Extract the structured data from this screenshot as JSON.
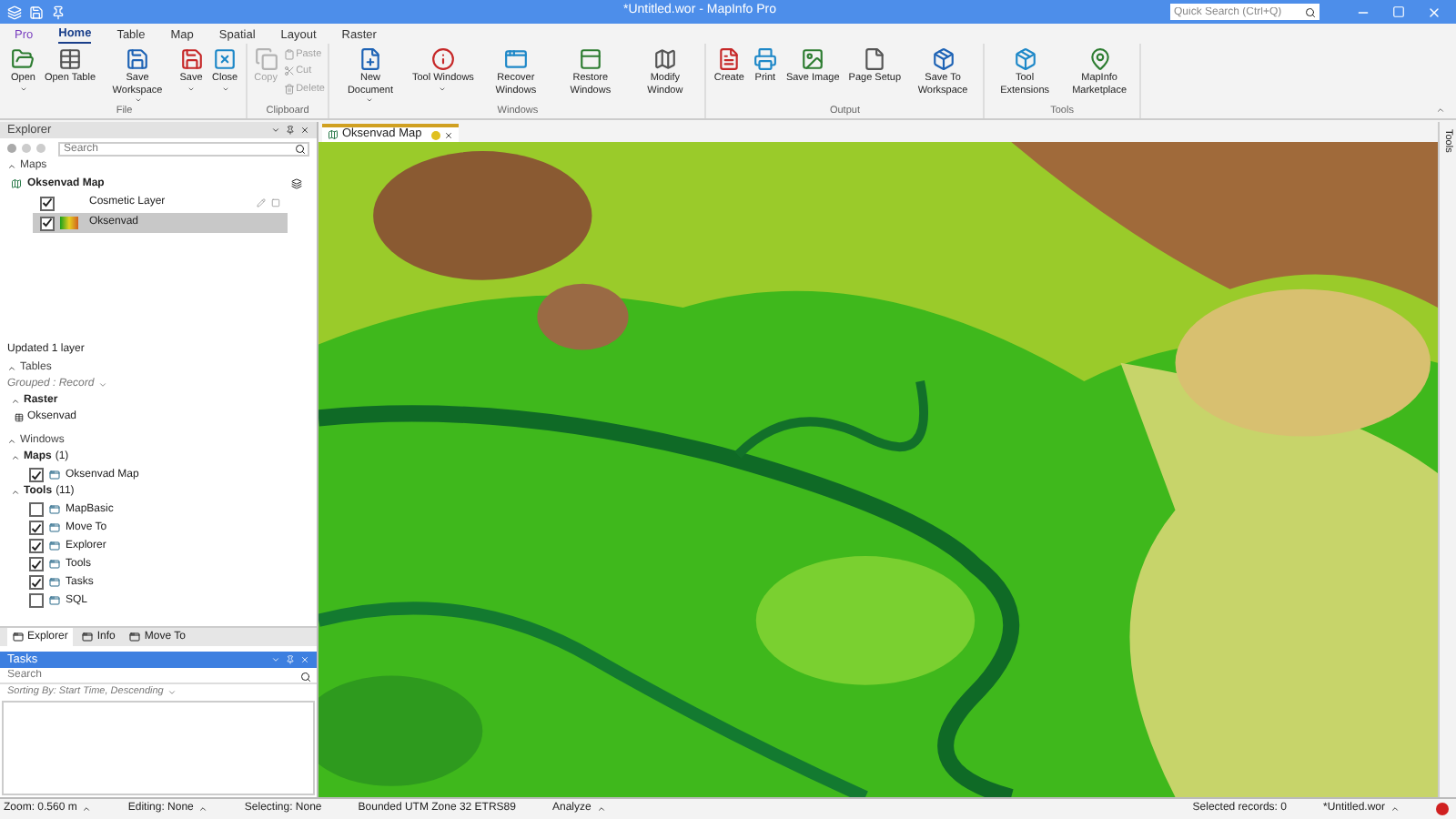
{
  "window": {
    "title": "*Untitled.wor - MapInfo Pro"
  },
  "quick_search": {
    "placeholder": "Quick Search (Ctrl+Q)"
  },
  "tabs": [
    {
      "label": "Pro",
      "selected": false
    },
    {
      "label": "Home",
      "selected": true
    },
    {
      "label": "Table",
      "selected": false
    },
    {
      "label": "Map",
      "selected": false
    },
    {
      "label": "Spatial",
      "selected": false
    },
    {
      "label": "Layout",
      "selected": false
    },
    {
      "label": "Raster",
      "selected": false
    }
  ],
  "ribbon": [
    {
      "label": "File",
      "buttons": [
        {
          "label": "Open",
          "disabled": false,
          "dropdown": true
        },
        {
          "label": "Open Table",
          "disabled": false,
          "dropdown": false
        },
        {
          "label": "Save Workspace",
          "disabled": false,
          "dropdown": true
        },
        {
          "label": "Save",
          "disabled": false,
          "dropdown": true
        },
        {
          "label": "Close",
          "disabled": false,
          "dropdown": true
        }
      ]
    },
    {
      "label": "Clipboard",
      "buttons": [
        {
          "label": "Copy",
          "disabled": true,
          "dropdown": false
        },
        {
          "label": "Paste",
          "disabled": true,
          "kind": "small"
        },
        {
          "label": "Cut",
          "disabled": true,
          "kind": "small"
        },
        {
          "label": "Delete",
          "disabled": true,
          "kind": "small"
        }
      ]
    },
    {
      "label": "Windows",
      "buttons": [
        {
          "label": "New Document",
          "disabled": false,
          "dropdown": true
        },
        {
          "label": "Tool Windows",
          "disabled": false,
          "dropdown": true
        },
        {
          "label": "Recover Windows",
          "disabled": false,
          "dropdown": false
        },
        {
          "label": "Restore Windows",
          "disabled": false,
          "dropdown": false
        },
        {
          "label": "Modify Window",
          "disabled": false,
          "dropdown": false
        }
      ]
    },
    {
      "label": "Output",
      "buttons": [
        {
          "label": "Create",
          "disabled": false,
          "dropdown": false
        },
        {
          "label": "Print",
          "disabled": false,
          "dropdown": false
        },
        {
          "label": "Save Image",
          "disabled": false,
          "dropdown": false
        },
        {
          "label": "Page Setup",
          "disabled": false,
          "dropdown": false
        },
        {
          "label": "Save To Workspace",
          "disabled": false,
          "dropdown": false
        }
      ]
    },
    {
      "label": "Tools",
      "buttons": [
        {
          "label": "Tool Extensions",
          "disabled": false,
          "dropdown": false
        },
        {
          "label": "MapInfo Marketplace",
          "disabled": false,
          "dropdown": false
        }
      ]
    }
  ],
  "explorer": {
    "title": "Explorer",
    "search": {
      "placeholder": "Search"
    },
    "maps_heading": "Maps",
    "map_name": "Oksenvad Map",
    "layers": [
      {
        "name": "Cosmetic Layer",
        "checked": true,
        "selected": false,
        "kind": "cosmetic"
      },
      {
        "name": "Oksenvad",
        "checked": true,
        "selected": true,
        "kind": "raster"
      }
    ],
    "message": "Updated 1 layer",
    "tables_heading": "Tables",
    "grouping": "Grouped : Record",
    "raster_heading": "Raster",
    "raster_items": [
      "Oksenvad"
    ],
    "windows_heading": "Windows",
    "window_groups": [
      {
        "name": "Maps",
        "count": "(1)",
        "items": [
          {
            "name": "Oksenvad Map",
            "checked": true
          }
        ]
      },
      {
        "name": "Tools",
        "count": "(11)",
        "items": [
          {
            "name": "MapBasic",
            "checked": false
          },
          {
            "name": "Move To",
            "checked": true
          },
          {
            "name": "Explorer",
            "checked": true
          },
          {
            "name": "Tools",
            "checked": true
          },
          {
            "name": "Tasks",
            "checked": true
          },
          {
            "name": "SQL",
            "checked": false
          }
        ]
      }
    ]
  },
  "panel_tabs": [
    {
      "label": "Explorer",
      "selected": true
    },
    {
      "label": "Info",
      "selected": false
    },
    {
      "label": "Move To",
      "selected": false
    }
  ],
  "tasks": {
    "title": "Tasks",
    "search": {
      "placeholder": "Search"
    },
    "sorting": "Sorting By: Start Time, Descending"
  },
  "map_tab": {
    "title": "Oksenvad Map"
  },
  "side_tab": "Tools",
  "status_bar": [
    {
      "text": "Zoom: 0.560 m",
      "menu": true
    },
    {
      "text": "Editing: None",
      "menu": true
    },
    {
      "text": "Selecting: None",
      "menu": false
    },
    {
      "text": "Bounded UTM Zone 32 ETRS89",
      "menu": false
    },
    {
      "text": "Analyze",
      "menu": true
    }
  ],
  "status_right": [
    {
      "text": "Selected records: 0",
      "menu": false
    },
    {
      "text": "*Untitled.wor",
      "menu": true
    }
  ]
}
